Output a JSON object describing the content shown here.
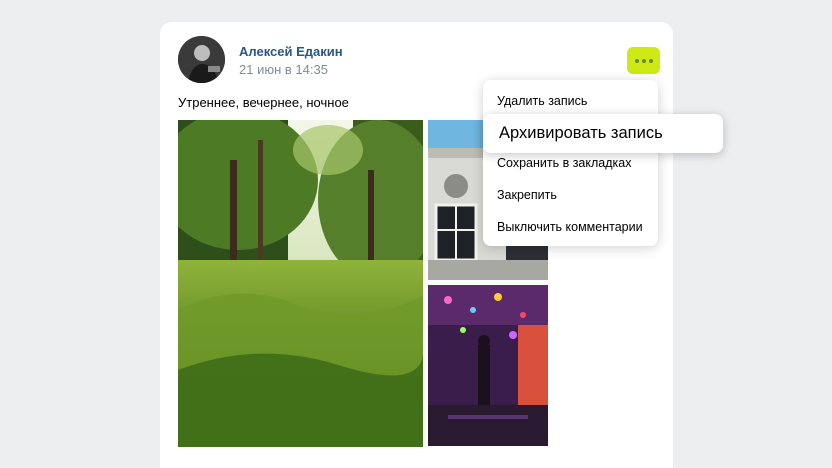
{
  "post": {
    "author": "Алексей Едакин",
    "date": "21 июн в 14:35",
    "text": "Утреннее, вечернее, ночное",
    "more_icon": "more-horizontal-icon"
  },
  "menu": {
    "items": [
      "Удалить запись",
      "Архивировать запись",
      "Сохранить в закладках",
      "Закрепить",
      "Выключить комментарии"
    ],
    "highlighted_index": 1
  },
  "colors": {
    "background": "#edeef0",
    "author": "#2a5885",
    "date": "#818c99",
    "more_button": "#cdea17"
  }
}
